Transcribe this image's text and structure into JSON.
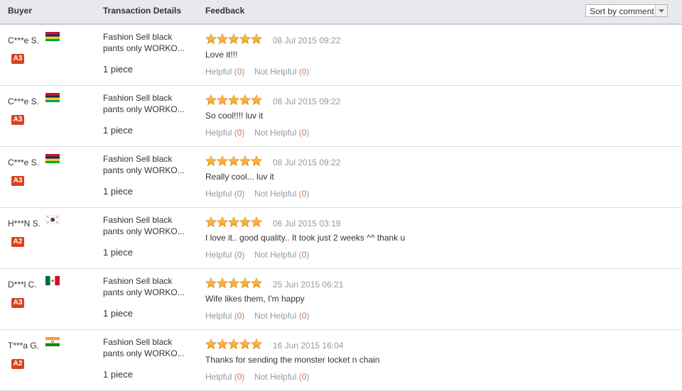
{
  "columns": {
    "buyer": "Buyer",
    "transaction": "Transaction Details",
    "feedback": "Feedback"
  },
  "sort": {
    "label": "Sort by comment"
  },
  "colors": {
    "star": "#f29a22",
    "level_badge": "#d9421c",
    "count": "#e4722c"
  },
  "labels": {
    "helpful": "Helpful",
    "not_helpful": "Not Helpful"
  },
  "reviews": [
    {
      "buyer": "C***e S.",
      "flag": "flag-mauritius-icon",
      "level": "A3",
      "product": "Fashion Sell black pants only WORKO...",
      "quantity": "1 piece",
      "stars": 5,
      "date": "08 Jul 2015 09:22",
      "comment": "Love it!!!",
      "helpful_count": "0",
      "not_helpful_count": "0"
    },
    {
      "buyer": "C***e S.",
      "flag": "flag-mauritius-icon",
      "level": "A3",
      "product": "Fashion Sell black pants only WORKO...",
      "quantity": "1 piece",
      "stars": 5,
      "date": "08 Jul 2015 09:22",
      "comment": "So cool!!!! luv it",
      "helpful_count": "0",
      "not_helpful_count": "0"
    },
    {
      "buyer": "C***e S.",
      "flag": "flag-mauritius-icon",
      "level": "A3",
      "product": "Fashion Sell black pants only WORKO...",
      "quantity": "1 piece",
      "stars": 5,
      "date": "08 Jul 2015 09:22",
      "comment": "Really cool... luv it",
      "helpful_count": "0",
      "not_helpful_count": "0"
    },
    {
      "buyer": "H***N S.",
      "flag": "flag-korea-icon",
      "level": "A2",
      "product": "Fashion Sell black pants only WORKO...",
      "quantity": "1 piece",
      "stars": 5,
      "date": "06 Jul 2015 03:19",
      "comment": "I love it.. good quality.. It took just 2 weeks ^^ thank u",
      "helpful_count": "0",
      "not_helpful_count": "0"
    },
    {
      "buyer": "D***l C.",
      "flag": "flag-mexico-icon",
      "level": "A3",
      "product": "Fashion Sell black pants only WORKO...",
      "quantity": "1 piece",
      "stars": 5,
      "date": "25 Jun 2015 06:21",
      "comment": "Wife likes them, I'm happy",
      "helpful_count": "0",
      "not_helpful_count": "0"
    },
    {
      "buyer": "T***a G.",
      "flag": "flag-india-icon",
      "level": "A2",
      "product": "Fashion Sell black pants only WORKO...",
      "quantity": "1 piece",
      "stars": 5,
      "date": "16 Jun 2015 16:04",
      "comment": "Thanks for sending the monster locket n chain",
      "helpful_count": "0",
      "not_helpful_count": "0"
    }
  ]
}
